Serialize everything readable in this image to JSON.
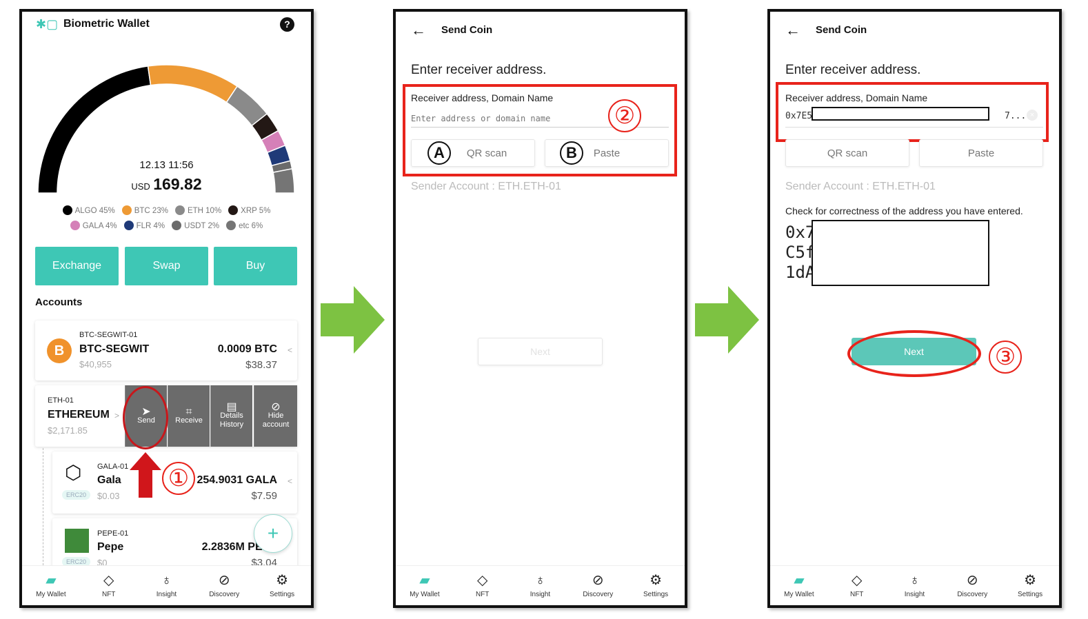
{
  "screen1": {
    "app_title": "Biometric Wallet",
    "help_icon": "?",
    "timestamp": "12.13 11:56",
    "currency": "USD",
    "total": "169.82",
    "allocation": [
      {
        "label": "ALGO 45%",
        "pct": 45,
        "color": "#000000"
      },
      {
        "label": "BTC 23%",
        "pct": 23,
        "color": "#ee9a35"
      },
      {
        "label": "ETH 10%",
        "pct": 10,
        "color": "#8a8a8a"
      },
      {
        "label": "XRP 5%",
        "pct": 5,
        "color": "#231815"
      },
      {
        "label": "GALA 4%",
        "pct": 4,
        "color": "#d580b8"
      },
      {
        "label": "FLR 4%",
        "pct": 4,
        "color": "#1f3a78"
      },
      {
        "label": "USDT 2%",
        "pct": 2,
        "color": "#6b6b6b"
      },
      {
        "label": "etc 6%",
        "pct": 6,
        "color": "#757575"
      }
    ],
    "buttons": {
      "exchange": "Exchange",
      "swap": "Swap",
      "buy": "Buy"
    },
    "accounts_heading": "Accounts",
    "btc": {
      "id": "BTC-SEGWIT-01",
      "name": "BTC-SEGWIT",
      "price": "$40,955",
      "amount": "0.0009 BTC",
      "value": "$38.37",
      "chevron": "<"
    },
    "eth": {
      "id": "ETH-01",
      "name": "ETHEREUM",
      "value": "$2,171.85",
      "chevron": ">",
      "actions": {
        "send": "Send",
        "receive": "Receive",
        "details_1": "Details",
        "details_2": "History",
        "hide_1": "Hide",
        "hide_2": "account"
      }
    },
    "gala": {
      "id": "GALA-01",
      "name": "Gala",
      "badge": "ERC20",
      "price": "$0.03",
      "amount": "254.9031 GALA",
      "value": "$7.59",
      "chevron": "<"
    },
    "pepe": {
      "id": "PEPE-01",
      "name": "Pepe",
      "badge": "ERC20",
      "price": "$0",
      "amount": "2.2836M PEPE",
      "value": "$3.04",
      "chevron": "<"
    },
    "fab": "+",
    "step": "①"
  },
  "nav": {
    "wallet": "My Wallet",
    "nft": "NFT",
    "insight": "Insight",
    "discovery": "Discovery",
    "settings": "Settings"
  },
  "send": {
    "title": "Send Coin",
    "heading": "Enter receiver address.",
    "field_label": "Receiver address, Domain Name",
    "placeholder": "Enter address or domain name",
    "qr": "QR scan",
    "paste": "Paste",
    "marker_a": "A",
    "marker_b": "B",
    "sender": "Sender Account : ETH.ETH-01",
    "next": "Next",
    "step2": "②",
    "value_start": "0x7E5",
    "value_end": "7...",
    "check_text": "Check for correctness of the address you have entered.",
    "addr_lines": [
      "0x7",
      "C5f",
      "1dA"
    ],
    "step3": "③"
  },
  "colors": {
    "accent": "#3ec7b5",
    "annotation": "#e8231b",
    "arrow": "#7dc242"
  }
}
